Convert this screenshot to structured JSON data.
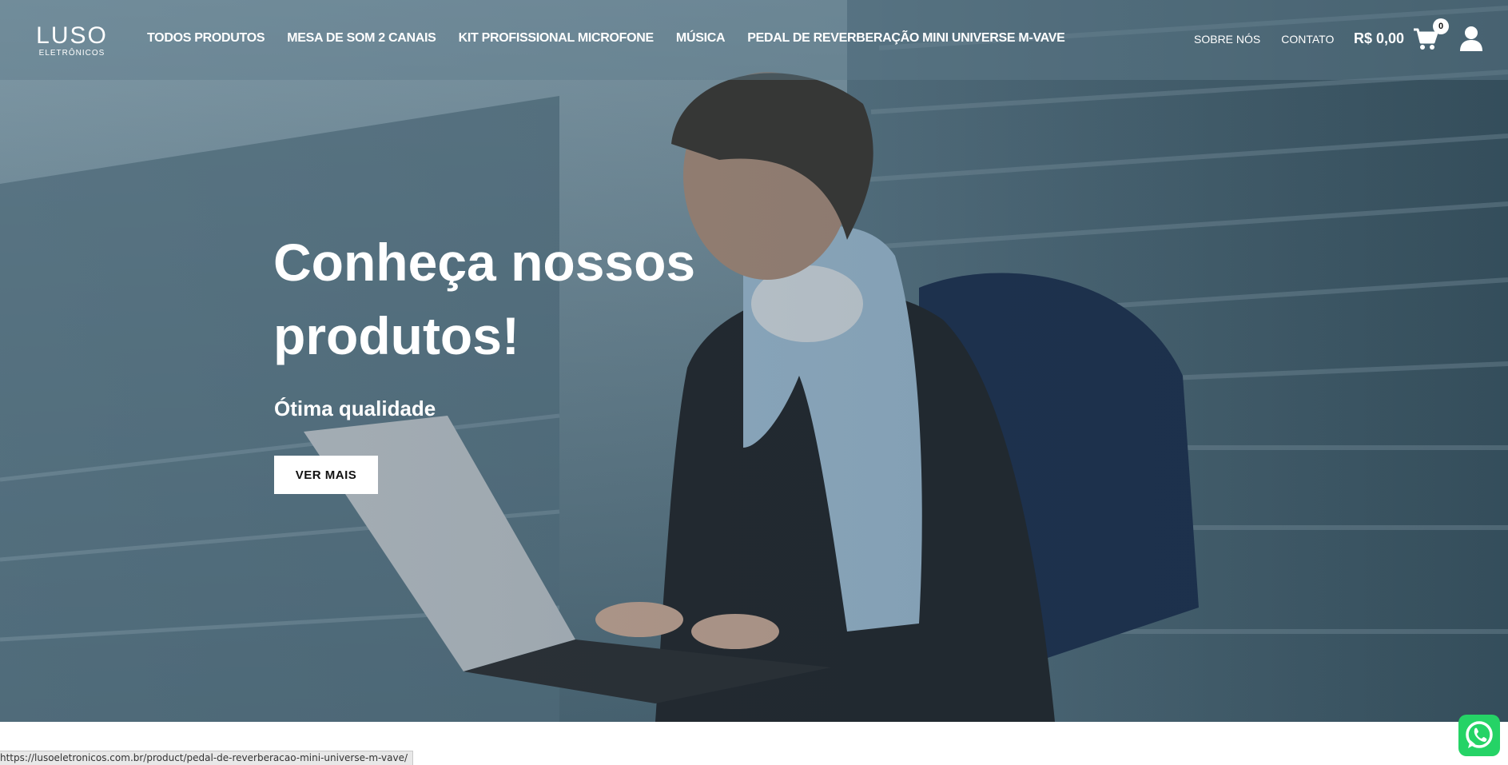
{
  "brand": {
    "logo_main": "LUSO",
    "logo_sub": "ELETRÔNICOS"
  },
  "nav": {
    "items": [
      {
        "label": "TODOS PRODUTOS"
      },
      {
        "label": "MESA DE SOM 2 CANAIS"
      },
      {
        "label": "KIT PROFISSIONAL MICROFONE"
      },
      {
        "label": "MÚSICA"
      },
      {
        "label": "PEDAL DE REVERBERAÇÃO MINI UNIVERSE M-VAVE"
      }
    ],
    "right": [
      {
        "label": "SOBRE NÓS"
      },
      {
        "label": "CONTATO"
      }
    ]
  },
  "cart": {
    "total": "R$ 0,00",
    "count": "0",
    "icon": "cart-icon"
  },
  "account": {
    "icon": "user-icon"
  },
  "hero": {
    "title": "Conheça nossos produtos!",
    "subtitle": "Ótima qualidade",
    "button": "VER MAIS"
  },
  "status_bar": {
    "url": "https://lusoeletronicos.com.br/product/pedal-de-reverberacao-mini-universe-m-vave/"
  },
  "whatsapp": {
    "icon": "whatsapp-icon",
    "color": "#25d366"
  },
  "colors": {
    "header_overlay": "#5f7d8c",
    "text": "#ffffff",
    "button_bg": "#ffffff"
  }
}
